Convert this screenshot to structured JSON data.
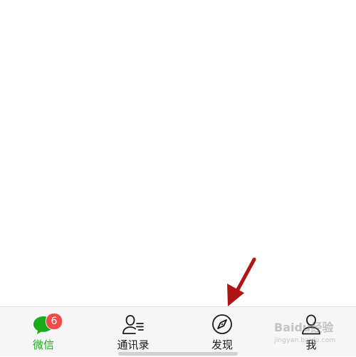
{
  "tabbar": {
    "tabs": [
      {
        "label": "微信",
        "icon": "chat-bubble-icon",
        "badge": "6",
        "active": true
      },
      {
        "label": "通讯录",
        "icon": "contacts-icon",
        "active": false
      },
      {
        "label": "发现",
        "icon": "compass-icon",
        "active": false
      },
      {
        "label": "我",
        "icon": "person-icon",
        "active": false
      }
    ]
  },
  "annotation": {
    "type": "arrow",
    "color": "#b01515",
    "points_to": "发现"
  },
  "watermark": {
    "main": "Baidu经验",
    "sub": "jingyan.baidu.com"
  },
  "colors": {
    "accent": "#1aad19",
    "badge": "#f04b4b",
    "tabbar_bg": "#f6f6f6"
  }
}
